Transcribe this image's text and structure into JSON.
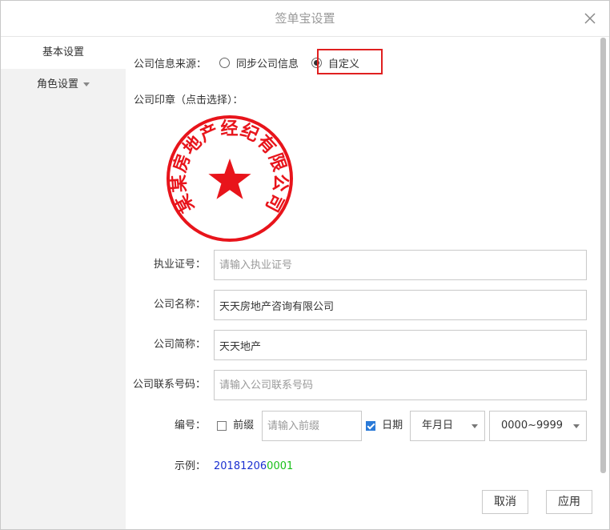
{
  "dialog": {
    "title": "签单宝设置"
  },
  "sidebar": {
    "items": [
      {
        "label": "基本设置"
      },
      {
        "label": "角色设置"
      }
    ]
  },
  "source": {
    "label": "公司信息来源：",
    "options": [
      {
        "label": "同步公司信息",
        "checked": false
      },
      {
        "label": "自定义",
        "checked": true
      }
    ]
  },
  "seal": {
    "label": "公司印章（点击选择）：",
    "text": "某某房地产经纪有限公司",
    "color": "#e8141b"
  },
  "fields": {
    "license": {
      "label": "执业证号：",
      "value": "",
      "placeholder": "请输入执业证号"
    },
    "name": {
      "label": "公司名称：",
      "value": "天天房地产咨询有限公司",
      "placeholder": ""
    },
    "short": {
      "label": "公司简称：",
      "value": "天天地产",
      "placeholder": ""
    },
    "phone": {
      "label": "公司联系号码：",
      "value": "",
      "placeholder": "请输入公司联系号码"
    }
  },
  "numbering": {
    "label": "编号：",
    "prefix_label": "前缀",
    "prefix_checked": false,
    "prefix_placeholder": "请输入前缀",
    "date_label": "日期",
    "date_checked": true,
    "date_format": "年月日",
    "range": "0000~9999"
  },
  "example": {
    "label": "示例：",
    "date_part": "20181206",
    "seq_part": "0001",
    "date_color": "#1a2fd0",
    "seq_color": "#18c018"
  },
  "buttons": {
    "cancel": "取消",
    "apply": "应用"
  }
}
